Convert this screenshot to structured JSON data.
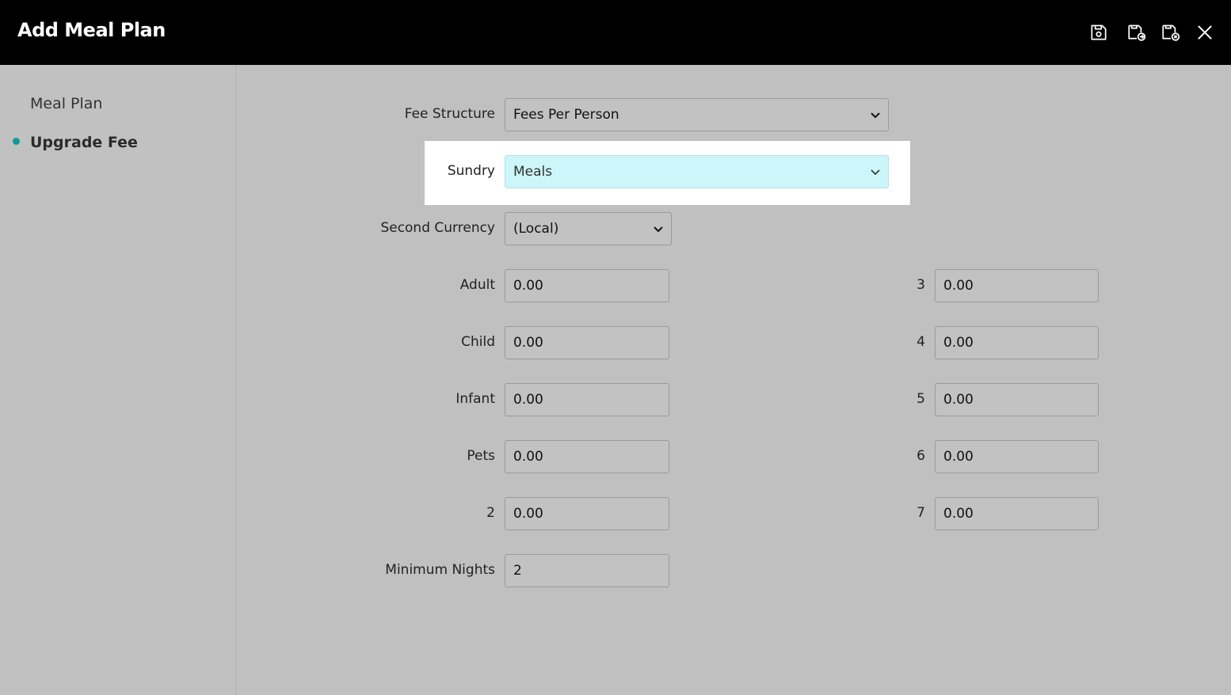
{
  "window": {
    "title": "Add Meal Plan"
  },
  "toolbar": {
    "save_icon": "save-icon",
    "save_new_icon": "save-and-new-icon",
    "save_close_icon": "save-and-close-icon",
    "close_icon": "close-icon"
  },
  "sidebar": {
    "items": [
      {
        "label": "Meal Plan",
        "active": false
      },
      {
        "label": "Upgrade Fee",
        "active": true
      }
    ],
    "accent": "#0e9a9a"
  },
  "form": {
    "fee_structure": {
      "label": "Fee Structure",
      "value": "Fees Per Person"
    },
    "sundry": {
      "label": "Sundry",
      "value": "Meals"
    },
    "second_currency": {
      "label": "Second Currency",
      "value": "(Local)"
    },
    "adult": {
      "label": "Adult",
      "value": "0.00"
    },
    "child": {
      "label": "Child",
      "value": "0.00"
    },
    "infant": {
      "label": "Infant",
      "value": "0.00"
    },
    "pets": {
      "label": "Pets",
      "value": "0.00"
    },
    "two": {
      "label": "2",
      "value": "0.00"
    },
    "three": {
      "label": "3",
      "value": "0.00"
    },
    "four": {
      "label": "4",
      "value": "0.00"
    },
    "five": {
      "label": "5",
      "value": "0.00"
    },
    "six": {
      "label": "6",
      "value": "0.00"
    },
    "seven": {
      "label": "7",
      "value": "0.00"
    },
    "minimum_nights": {
      "label": "Minimum Nights",
      "value": "2"
    }
  }
}
